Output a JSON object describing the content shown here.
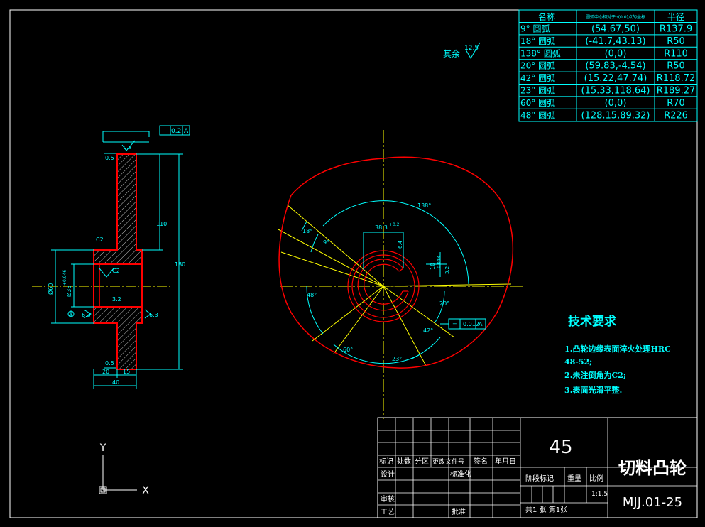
{
  "colors": {
    "background": "#000000",
    "frame": "#ffffff",
    "dimension": "#00ffff",
    "contour": "#ff0000",
    "centerline": "#ffff00",
    "hatch": "#c0c0c0"
  },
  "arc_table": {
    "header": [
      "名称",
      "圆弧中心相对于o(0,0)点的坐标",
      "半径"
    ],
    "rows": [
      [
        "9° 圆弧",
        "(54.67,50)",
        "R137.9"
      ],
      [
        "18° 圆弧",
        "(-41.7,43.13)",
        "R50"
      ],
      [
        "138° 圆弧",
        "(0,0)",
        "R110"
      ],
      [
        "20° 圆弧",
        "(59.83,-4.54)",
        "R50"
      ],
      [
        "42° 圆弧",
        "(15.22,47.74)",
        "R118.72"
      ],
      [
        "23° 圆弧",
        "(15.33,118.64)",
        "R189.27"
      ],
      [
        "60° 圆弧",
        "(0,0)",
        "R70"
      ],
      [
        "48° 圆弧",
        "(128.15,89.32)",
        "R226"
      ]
    ]
  },
  "roughness_note": {
    "label": "其余",
    "value": "12.5"
  },
  "section_view": {
    "flatness_tolerance": "0.2",
    "datum_ref": "A",
    "roughness_top": "0.8",
    "roughness_bottom": "6.3",
    "dim_left_1": "0.5",
    "dim_left_2": "0.5",
    "chamfer_top": "C2",
    "chamfer_inner": "C2",
    "roughness_bore": "3.2",
    "roughness_datum": "6.3",
    "dim_diameter_60": "Ø60",
    "dim_bore": "Ø35",
    "dim_bore_tol": "+0.046",
    "dim_height_inner": "110",
    "dim_height_total": "180",
    "datum_label": "A",
    "dim_bottom_1": "20",
    "dim_bottom_2": "15",
    "dim_bottom_total": "40"
  },
  "cam_view": {
    "angle_138": "138°",
    "angle_18": "18°",
    "angle_9": "9°",
    "angle_48": "48°",
    "angle_60": "60°",
    "angle_23": "23°",
    "angle_42": "42°",
    "angle_20": "20°",
    "keyway_width": "38.3",
    "keyway_tol": "+0.2",
    "keyway_depth": "10",
    "keyway_depth_tol": "-0.043",
    "roughness_1": "6.4",
    "roughness_2": "3.2",
    "tolerance_symbol": "=",
    "tolerance_value": "0.012",
    "tolerance_datum": "A"
  },
  "tech_requirements": {
    "title": "技术要求",
    "items": [
      "1.凸轮边缘表面淬火处理HRC",
      "48-52;",
      "2.未注倒角为C2;",
      "3.表面光滑平整."
    ]
  },
  "title_block": {
    "material": "45",
    "part_name": "切料凸轮",
    "drawing_no": "MJJ.01-25",
    "labels": [
      "标记",
      "处数",
      "分区",
      "更改文件号",
      "签名",
      "年月日"
    ],
    "design": "设计",
    "standardization": "标准化",
    "review": "审核",
    "process": "工艺",
    "approve": "批准",
    "stage_mark": "阶段标记",
    "weight": "重量",
    "scale": "比例",
    "scale_value": "1:1.5",
    "sheet_info": "共1  张 第1张"
  },
  "ucs": {
    "y_label": "Y",
    "x_label": "X"
  }
}
